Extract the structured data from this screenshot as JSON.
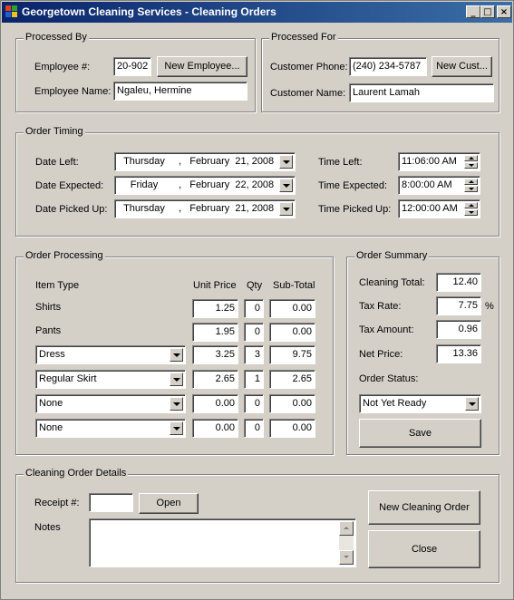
{
  "window": {
    "title": "Georgetown Cleaning Services - Cleaning Orders",
    "controls": {
      "minimize": "_",
      "maximize": "□",
      "close": "×"
    }
  },
  "processed_by": {
    "label": "Processed By",
    "employee_number_label": "Employee #:",
    "employee_number": "20-902",
    "new_employee_button": "New Employee...",
    "employee_name_label": "Employee Name:",
    "employee_name": "Ngaleu, Hermine"
  },
  "processed_for": {
    "label": "Processed For",
    "customer_phone_label": "Customer Phone:",
    "customer_phone": "(240) 234-5787",
    "new_customer_button": "New Cust...",
    "customer_name_label": "Customer Name:",
    "customer_name": "Laurent Lamah"
  },
  "order_timing": {
    "label": "Order Timing",
    "date_left_label": "Date Left:",
    "date_left": {
      "day": "Thursday",
      "rest": ",   February  21, 2008"
    },
    "date_expected_label": "Date Expected:",
    "date_expected": {
      "day": "Friday",
      "rest": ",   February  22, 2008"
    },
    "date_picked_up_label": "Date Picked Up:",
    "date_picked_up": {
      "day": "Thursday",
      "rest": ",   February  21, 2008"
    },
    "time_left_label": "Time Left:",
    "time_left": "11:06:00 AM",
    "time_expected_label": "Time Expected:",
    "time_expected": "8:00:00 AM",
    "time_picked_up_label": "Time Picked Up:",
    "time_picked_up": "12:00:00 AM"
  },
  "order_processing": {
    "label": "Order Processing",
    "headers": {
      "item_type": "Item Type",
      "unit_price": "Unit Price",
      "qty": "Qty",
      "sub_total": "Sub-Total"
    },
    "rows": [
      {
        "item": "Shirts",
        "unit_price": "1.25",
        "qty": "0",
        "sub_total": "0.00"
      },
      {
        "item": "Pants",
        "unit_price": "1.95",
        "qty": "0",
        "sub_total": "0.00"
      },
      {
        "item": "Dress",
        "unit_price": "3.25",
        "qty": "3",
        "sub_total": "9.75"
      },
      {
        "item": "Regular Skirt",
        "unit_price": "2.65",
        "qty": "1",
        "sub_total": "2.65"
      },
      {
        "item": "None",
        "unit_price": "0.00",
        "qty": "0",
        "sub_total": "0.00"
      },
      {
        "item": "None",
        "unit_price": "0.00",
        "qty": "0",
        "sub_total": "0.00"
      }
    ]
  },
  "order_summary": {
    "label": "Order Summary",
    "cleaning_total_label": "Cleaning Total:",
    "cleaning_total": "12.40",
    "tax_rate_label": "Tax Rate:",
    "tax_rate": "7.75",
    "percent_sign": "%",
    "tax_amount_label": "Tax Amount:",
    "tax_amount": "0.96",
    "net_price_label": "Net Price:",
    "net_price": "13.36",
    "order_status_label": "Order Status:",
    "order_status": "Not Yet Ready",
    "save_button": "Save"
  },
  "details": {
    "label": "Cleaning Order Details",
    "receipt_label": "Receipt #:",
    "receipt_value": "",
    "open_button": "Open",
    "notes_label": "Notes",
    "notes_value": "",
    "new_order_button": "New Cleaning Order",
    "close_button": "Close"
  }
}
